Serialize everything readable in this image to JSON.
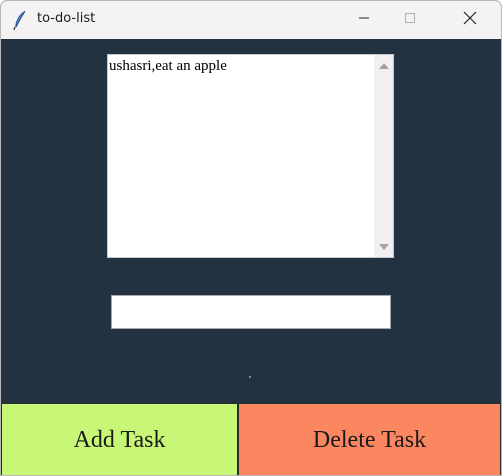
{
  "window": {
    "title": "to-do-list",
    "icon": "feather-icon"
  },
  "controls": {
    "minimize_icon": "minimize-icon",
    "maximize_icon": "maximize-icon",
    "close_icon": "close-icon"
  },
  "tasks": {
    "items": [
      "ushasri,eat an apple"
    ]
  },
  "entry": {
    "value": ""
  },
  "buttons": {
    "add_label": "Add Task",
    "delete_label": "Delete Task"
  },
  "colors": {
    "background": "#233240",
    "add_button": "#c8f777",
    "delete_button": "#fb8761"
  }
}
